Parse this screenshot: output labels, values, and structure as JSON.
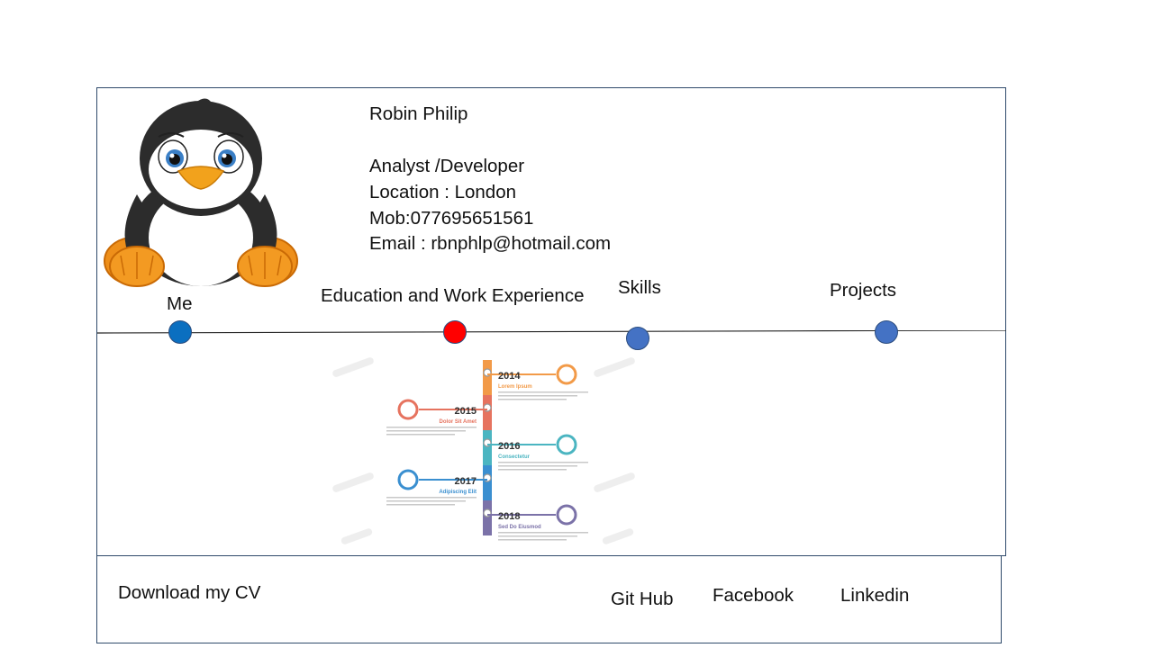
{
  "profile": {
    "name": "Robin Philip",
    "title": "Analyst /Developer",
    "location": "Location : London",
    "mobile": "Mob:077695651561",
    "email": "Email : rbnphlp@hotmail.com"
  },
  "nav": [
    {
      "label": "Me",
      "dot_color": "#0b6fc0"
    },
    {
      "label": "Education and Work Experience",
      "dot_color": "#ff0000"
    },
    {
      "label": "Skills",
      "dot_color": "#4472c4"
    },
    {
      "label": "Projects",
      "dot_color": "#4472c4"
    }
  ],
  "timeline_graphic": {
    "years": [
      "2014",
      "2015",
      "2016",
      "2017",
      "2018"
    ],
    "captions": [
      "Lorem Ipsum",
      "Dolor Sit Amet",
      "Consectetur",
      "Adipiscing Elit",
      "Sed Do Eiusmod"
    ],
    "colors": [
      "#f29a48",
      "#e6735f",
      "#4bb5c1",
      "#3a8fd0",
      "#7b72a8"
    ]
  },
  "footer": {
    "download_cv": "Download my CV",
    "github": "Git Hub",
    "facebook": "Facebook",
    "linkedin": "Linkedin"
  },
  "colors": {
    "frame_border": "#2f4a6b",
    "text": "#111111"
  }
}
